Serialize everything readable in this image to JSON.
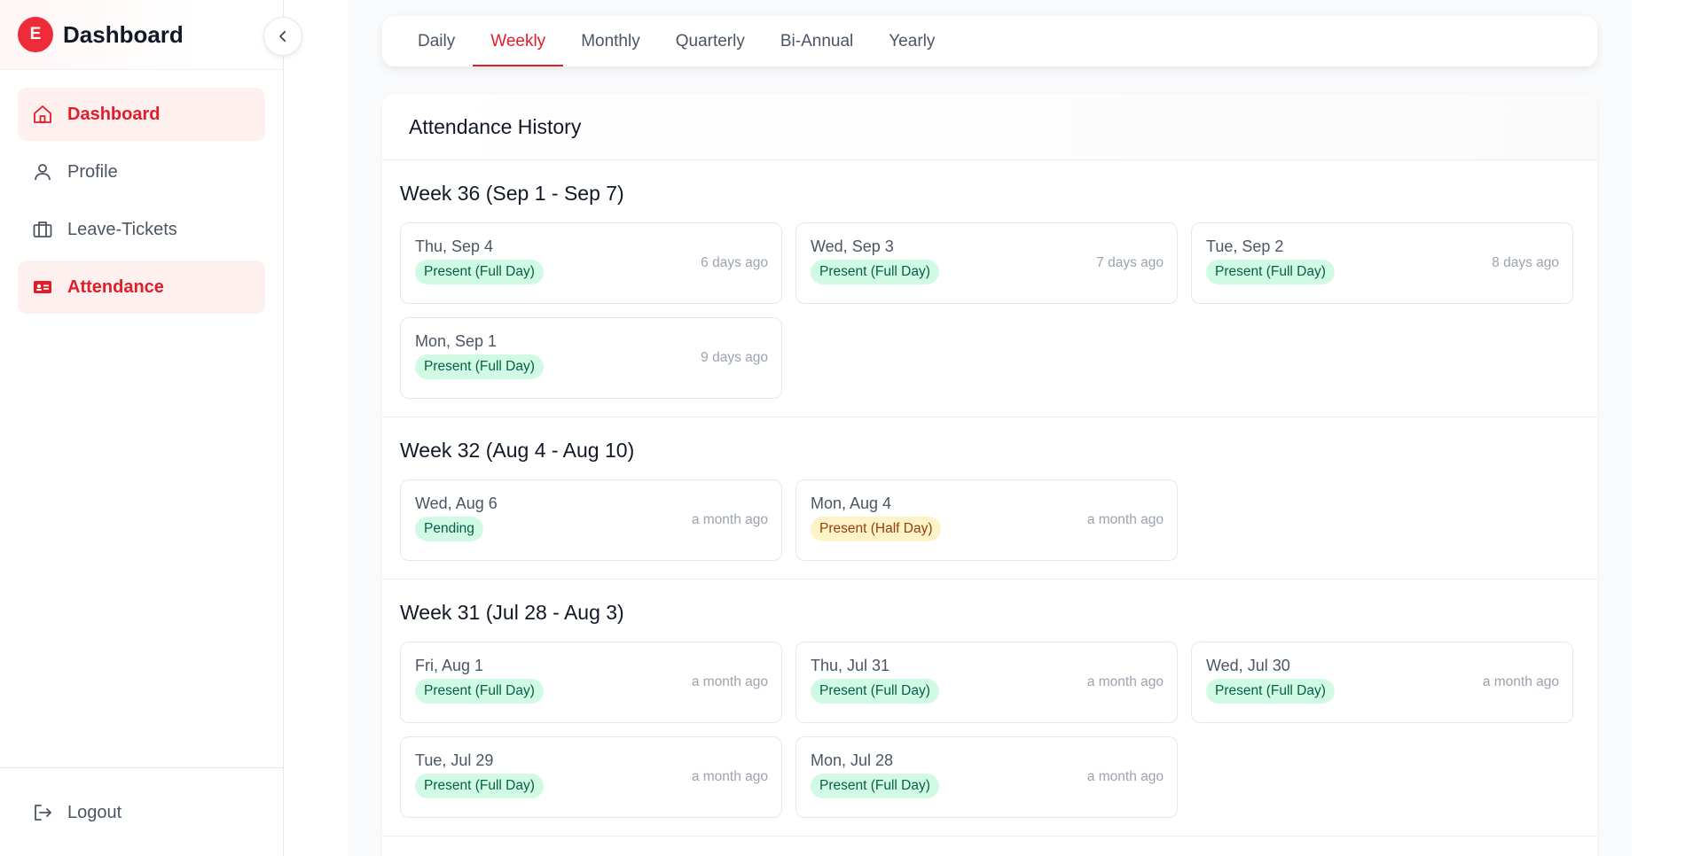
{
  "sidebar": {
    "logo_letter": "E",
    "brand": "Dashboard",
    "items": [
      {
        "label": "Dashboard",
        "icon": "home-icon",
        "active": true
      },
      {
        "label": "Profile",
        "icon": "user-icon",
        "active": false
      },
      {
        "label": "Leave-Tickets",
        "icon": "briefcase-icon",
        "active": false
      },
      {
        "label": "Attendance",
        "icon": "id-card-icon",
        "active": true
      }
    ],
    "logout": {
      "label": "Logout",
      "icon": "logout-icon"
    }
  },
  "tabs": [
    "Daily",
    "Weekly",
    "Monthly",
    "Quarterly",
    "Bi-Annual",
    "Yearly"
  ],
  "active_tab": "Weekly",
  "history": {
    "title": "Attendance History",
    "weeks": [
      {
        "title": "Week 36 (Sep 1 - Sep 7)",
        "days": [
          {
            "date": "Thu, Sep 4",
            "status": "Present (Full Day)",
            "ago": "6 days ago"
          },
          {
            "date": "Wed, Sep 3",
            "status": "Present (Full Day)",
            "ago": "7 days ago"
          },
          {
            "date": "Tue, Sep 2",
            "status": "Present (Full Day)",
            "ago": "8 days ago"
          },
          {
            "date": "Mon, Sep 1",
            "status": "Present (Full Day)",
            "ago": "9 days ago"
          }
        ]
      },
      {
        "title": "Week 32 (Aug 4 - Aug 10)",
        "days": [
          {
            "date": "Wed, Aug 6",
            "status": "Pending",
            "ago": "a month ago"
          },
          {
            "date": "Mon, Aug 4",
            "status": "Present (Half Day)",
            "ago": "a month ago"
          }
        ]
      },
      {
        "title": "Week 31 (Jul 28 - Aug 3)",
        "days": [
          {
            "date": "Fri, Aug 1",
            "status": "Present (Full Day)",
            "ago": "a month ago"
          },
          {
            "date": "Thu, Jul 31",
            "status": "Present (Full Day)",
            "ago": "a month ago"
          },
          {
            "date": "Wed, Jul 30",
            "status": "Present (Full Day)",
            "ago": "a month ago"
          },
          {
            "date": "Tue, Jul 29",
            "status": "Present (Full Day)",
            "ago": "a month ago"
          },
          {
            "date": "Mon, Jul 28",
            "status": "Present (Full Day)",
            "ago": "a month ago"
          }
        ]
      }
    ]
  },
  "colors": {
    "accent": "#e11d2a",
    "badge_green_bg": "#d1fae5",
    "badge_green_text": "#065f46",
    "badge_amber_bg": "#fef3c7",
    "badge_amber_text": "#92400e"
  }
}
